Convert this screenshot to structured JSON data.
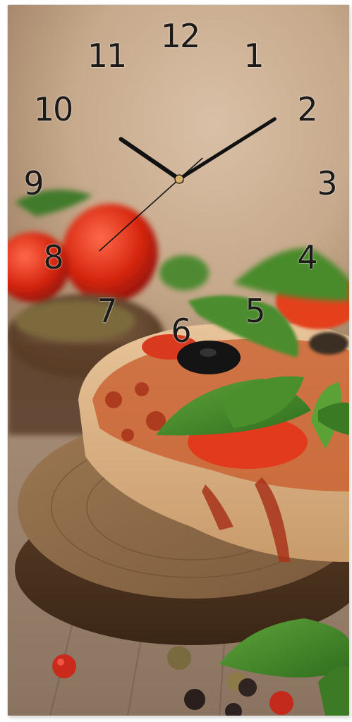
{
  "product": {
    "image_subject": "pizza with tomatoes and basil on a wooden board",
    "clock_face": {
      "numerals": [
        "12",
        "1",
        "2",
        "3",
        "4",
        "5",
        "6",
        "7",
        "8",
        "9",
        "10",
        "11"
      ],
      "time_shown": {
        "hour": 10,
        "minute": 9,
        "second": 38
      },
      "hand_color": "#111111",
      "center_color": "#d9b06a"
    }
  }
}
